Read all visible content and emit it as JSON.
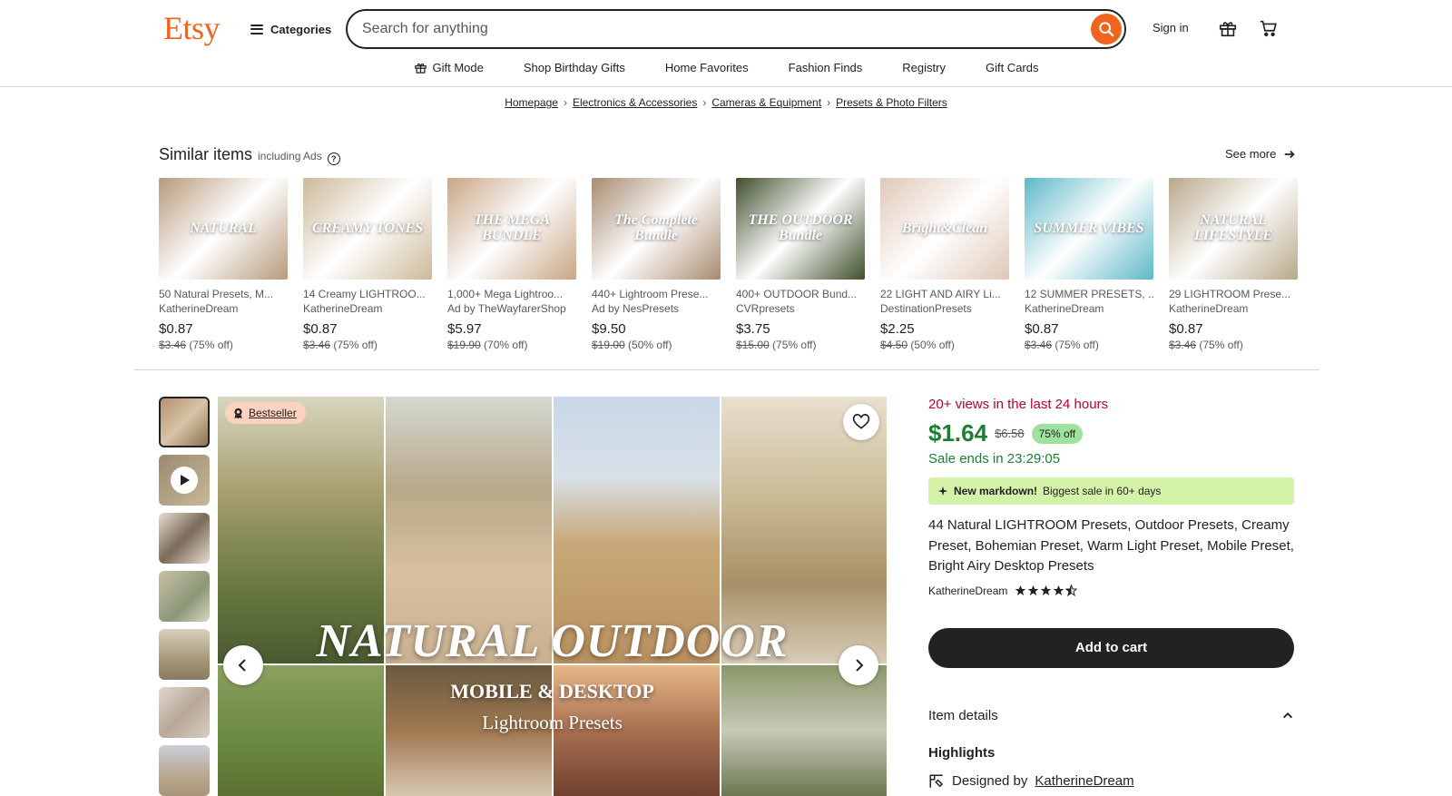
{
  "header": {
    "logo": "Etsy",
    "categories_label": "Categories",
    "search_placeholder": "Search for anything",
    "signin_label": "Sign in"
  },
  "nav": [
    "Gift Mode",
    "Shop Birthday Gifts",
    "Home Favorites",
    "Fashion Finds",
    "Registry",
    "Gift Cards"
  ],
  "breadcrumb": [
    "Homepage",
    "Electronics & Accessories",
    "Cameras & Equipment",
    "Presets & Photo Filters"
  ],
  "similar": {
    "title": "Similar items",
    "subtitle": "including Ads",
    "see_more": "See more",
    "items": [
      {
        "title": "50 Natural Presets, M...",
        "shop": "KatherineDream",
        "price": "$0.87",
        "orig": "$3.46",
        "off": "(75% off)",
        "thumb_text": "NATURAL",
        "color": "#b89a7a"
      },
      {
        "title": "14 Creamy LIGHTROO...",
        "shop": "KatherineDream",
        "price": "$0.87",
        "orig": "$3.46",
        "off": "(75% off)",
        "thumb_text": "CREAMY TONES",
        "color": "#cdb99a"
      },
      {
        "title": "1,000+ Mega Lightroo...",
        "shop": "Ad by TheWayfarerShop",
        "price": "$5.97",
        "orig": "$19.90",
        "off": "(70% off)",
        "thumb_text": "THE MEGA BUNDLE",
        "color": "#c9a585"
      },
      {
        "title": "440+ Lightroom Prese...",
        "shop": "Ad by NesPresets",
        "price": "$9.50",
        "orig": "$19.00",
        "off": "(50% off)",
        "thumb_text": "The Complete Bundle",
        "color": "#a88a70"
      },
      {
        "title": "400+ OUTDOOR Bund...",
        "shop": "CVRpresets",
        "price": "$3.75",
        "orig": "$15.00",
        "off": "(75% off)",
        "thumb_text": "THE OUTDOOR Bundle",
        "color": "#3f4f2c"
      },
      {
        "title": "22 LIGHT AND AIRY Li...",
        "shop": "DestinationPresets",
        "price": "$2.25",
        "orig": "$4.50",
        "off": "(50% off)",
        "thumb_text": "Bright&Clean",
        "color": "#e0c8b8"
      },
      {
        "title": "12 SUMMER PRESETS, ...",
        "shop": "KatherineDream",
        "price": "$0.87",
        "orig": "$3.46",
        "off": "(75% off)",
        "thumb_text": "SUMMER VIBES",
        "color": "#5fb8c8"
      },
      {
        "title": "29 LIGHTROOM Prese...",
        "shop": "KatherineDream",
        "price": "$0.87",
        "orig": "$3.46",
        "off": "(75% off)",
        "thumb_text": "NATURAL LIFESTYLE",
        "color": "#b8a88a"
      }
    ]
  },
  "gallery": {
    "badge": "Bestseller",
    "overlay_title": "NATURAL OUTDOOR",
    "overlay_sub": "MOBILE & DESKTOP",
    "overlay_sub2": "Lightroom Presets"
  },
  "listing": {
    "views": "20+ views in the last 24 hours",
    "price": "$1.64",
    "orig_price": "$6.58",
    "off": "75% off",
    "sale_ends": "Sale ends in 23:29:05",
    "markdown_bold": "New markdown!",
    "markdown_rest": "Biggest sale in 60+ days",
    "title": "44 Natural LIGHTROOM Presets, Outdoor Presets, Creamy Preset, Bohemian Preset, Warm Light Preset, Mobile Preset, Bright Airy Desktop Presets",
    "seller": "KatherineDream",
    "rating": 4.5,
    "add_to_cart": "Add to cart",
    "item_details": "Item details",
    "highlights": "Highlights",
    "designed_by": "Designed by",
    "designed_shop": "KatherineDream"
  },
  "colors": {
    "brand": "#f1641e",
    "sale_green": "#1e7d34",
    "views_red": "#b3003b"
  }
}
